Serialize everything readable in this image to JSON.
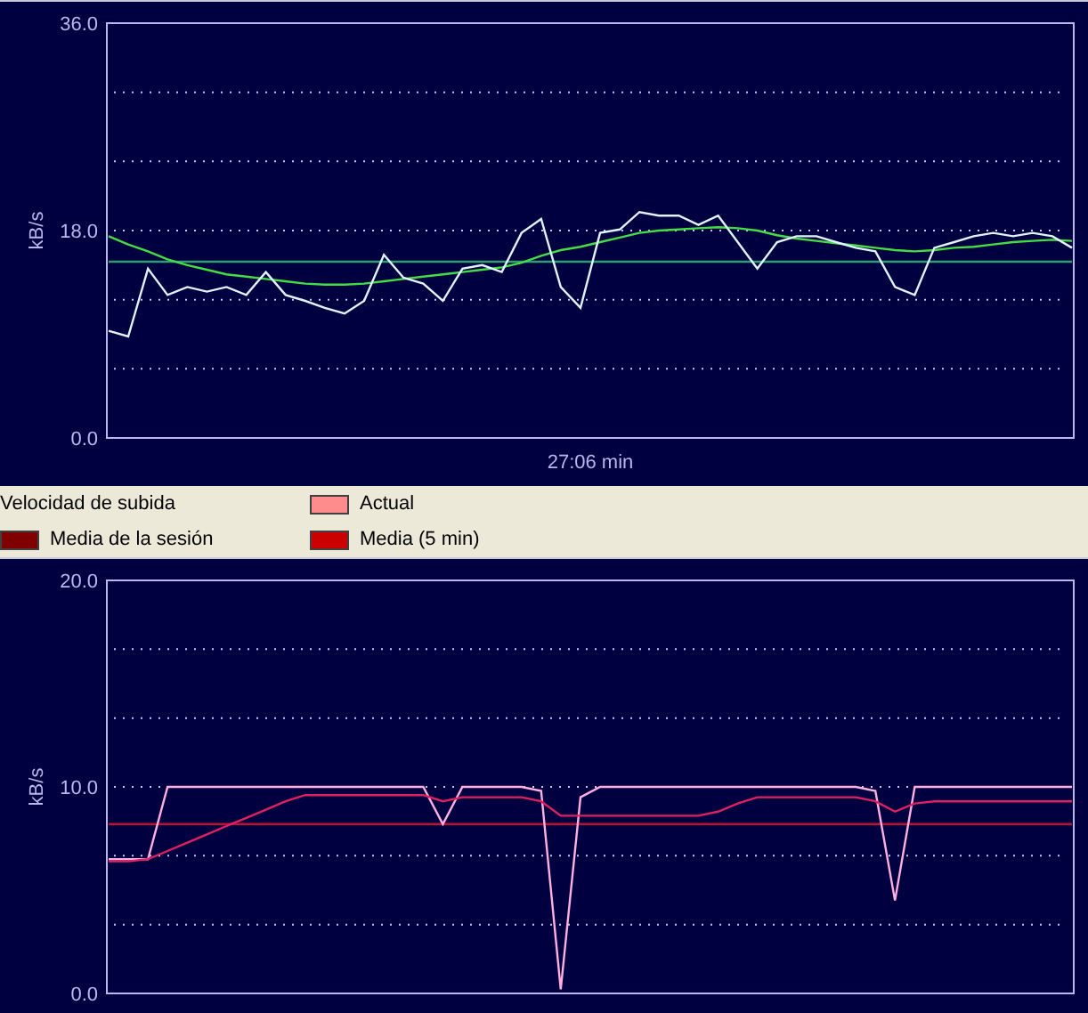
{
  "download_chart": {
    "chart_data": {
      "type": "line",
      "xlabel": "27:06 min",
      "ylabel": "kB/s",
      "ylim": [
        0,
        36
      ],
      "yticks": [
        {
          "value": 0,
          "label": "0.0"
        },
        {
          "value": 18,
          "label": "18.0"
        },
        {
          "value": 36,
          "label": "36.0"
        }
      ],
      "series": [
        {
          "color": "#2f9f6f",
          "values": [
            15.3,
            15.3,
            15.3,
            15.3,
            15.3,
            15.3,
            15.3,
            15.3,
            15.3,
            15.3,
            15.3,
            15.3,
            15.3,
            15.3,
            15.3,
            15.3,
            15.3,
            15.3,
            15.3,
            15.3,
            15.3,
            15.3,
            15.3,
            15.3,
            15.3,
            15.3,
            15.3,
            15.3,
            15.3,
            15.3,
            15.3,
            15.3,
            15.3,
            15.3,
            15.3,
            15.3,
            15.3,
            15.3,
            15.3,
            15.3,
            15.3,
            15.3,
            15.3,
            15.3,
            15.3,
            15.3,
            15.3,
            15.3,
            15.3,
            15.3
          ]
        },
        {
          "color": "#44dd44",
          "values": [
            17.5,
            16.8,
            16.2,
            15.5,
            15,
            14.6,
            14.2,
            14,
            13.8,
            13.6,
            13.4,
            13.3,
            13.3,
            13.4,
            13.6,
            13.8,
            14,
            14.2,
            14.4,
            14.6,
            14.8,
            15.2,
            15.8,
            16.3,
            16.6,
            17,
            17.4,
            17.8,
            18,
            18.1,
            18.2,
            18.3,
            18.2,
            18,
            17.6,
            17.3,
            17.1,
            16.9,
            16.7,
            16.5,
            16.3,
            16.2,
            16.3,
            16.5,
            16.6,
            16.8,
            17,
            17.1,
            17.2,
            17.1
          ]
        },
        {
          "color": "#e0f4ff",
          "values": [
            9.3,
            8.8,
            14.7,
            12.4,
            13.1,
            12.7,
            13.1,
            12.4,
            14.4,
            12.4,
            11.9,
            11.3,
            10.8,
            11.9,
            15.9,
            13.9,
            13.4,
            11.9,
            14.7,
            15,
            14.4,
            17.8,
            19,
            13.1,
            11.3,
            17.8,
            18.1,
            19.6,
            19.3,
            19.3,
            18.5,
            19.3,
            17,
            14.7,
            17,
            17.5,
            17.5,
            17,
            16.5,
            16.2,
            13.1,
            12.4,
            16.5,
            17,
            17.5,
            17.8,
            17.5,
            17.8,
            17.5,
            16.5
          ]
        }
      ]
    }
  },
  "legend": {
    "title": "Velocidad de subida",
    "items": [
      {
        "label": "Media de la sesión",
        "color": "#800000"
      },
      {
        "label": "Actual",
        "color": "#ff8c8c"
      },
      {
        "label": "Media (5 min)",
        "color": "#cc0000"
      }
    ]
  },
  "upload_chart": {
    "chart_data": {
      "type": "line",
      "ylabel": "kB/s",
      "ylim": [
        0,
        20
      ],
      "yticks": [
        {
          "value": 0,
          "label": "0.0"
        },
        {
          "value": 10,
          "label": "10.0"
        },
        {
          "value": 20,
          "label": "20.0"
        }
      ],
      "series": [
        {
          "color": "#c01030",
          "values": [
            8.2,
            8.2,
            8.2,
            8.2,
            8.2,
            8.2,
            8.2,
            8.2,
            8.2,
            8.2,
            8.2,
            8.2,
            8.2,
            8.2,
            8.2,
            8.2,
            8.2,
            8.2,
            8.2,
            8.2,
            8.2,
            8.2,
            8.2,
            8.2,
            8.2,
            8.2,
            8.2,
            8.2,
            8.2,
            8.2,
            8.2,
            8.2,
            8.2,
            8.2,
            8.2,
            8.2,
            8.2,
            8.2,
            8.2,
            8.2,
            8.2,
            8.2,
            8.2,
            8.2,
            8.2,
            8.2,
            8.2,
            8.2,
            8.2,
            8.2
          ]
        },
        {
          "color": "#ffb0e0",
          "values": [
            6.5,
            6.5,
            6.5,
            10,
            10,
            10,
            10,
            10,
            10,
            10,
            10,
            10,
            10,
            10,
            10,
            10,
            10,
            8.2,
            10,
            10,
            10,
            10,
            9.8,
            0.2,
            9.5,
            10,
            10,
            10,
            10,
            10,
            10,
            10,
            10,
            10,
            10,
            10,
            10,
            10,
            10,
            9.8,
            4.5,
            10,
            10,
            10,
            10,
            10,
            10,
            10,
            10,
            10
          ]
        },
        {
          "color": "#e02060",
          "values": [
            6.4,
            6.4,
            6.5,
            6.9,
            7.3,
            7.7,
            8.1,
            8.5,
            8.9,
            9.3,
            9.6,
            9.6,
            9.6,
            9.6,
            9.6,
            9.6,
            9.6,
            9.3,
            9.5,
            9.5,
            9.5,
            9.5,
            9.3,
            8.6,
            8.6,
            8.6,
            8.6,
            8.6,
            8.6,
            8.6,
            8.6,
            8.8,
            9.2,
            9.5,
            9.5,
            9.5,
            9.5,
            9.5,
            9.5,
            9.3,
            8.8,
            9.2,
            9.3,
            9.3,
            9.3,
            9.3,
            9.3,
            9.3,
            9.3,
            9.3
          ]
        }
      ]
    }
  }
}
